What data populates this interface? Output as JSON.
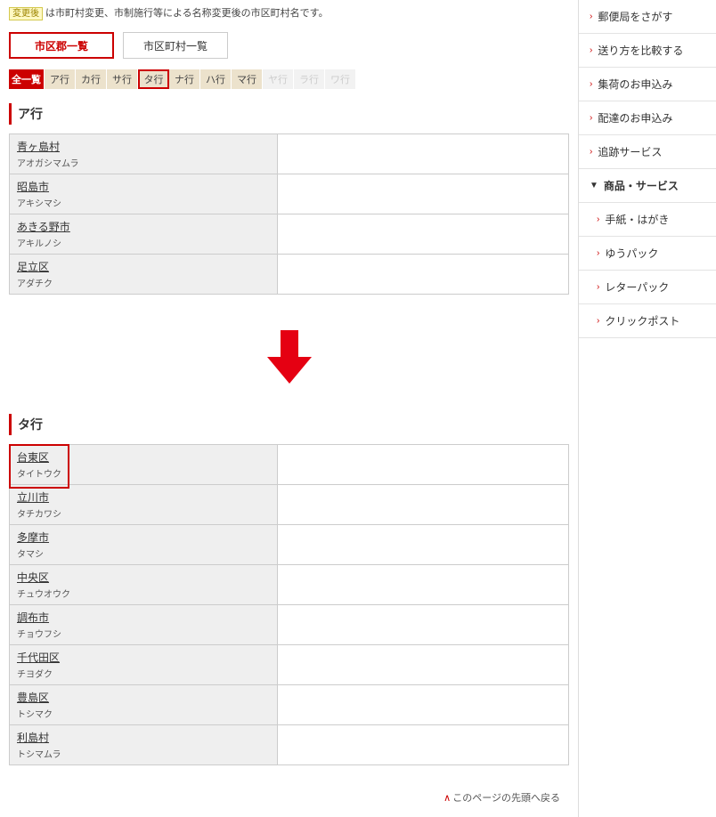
{
  "legend": {
    "badge": "変更後",
    "text": "は市町村変更、市制施行等による名称変更後の市区町村名です。"
  },
  "viewTabs": {
    "active": "市区郡一覧",
    "inactive": "市区町村一覧"
  },
  "kanaTabs": {
    "all": "全一覧",
    "items": [
      "ア行",
      "カ行",
      "サ行",
      "タ行",
      "ナ行",
      "ハ行",
      "マ行",
      "ヤ行",
      "ラ行",
      "ワ行"
    ],
    "highlighted": "タ行",
    "disabled": [
      "ヤ行",
      "ラ行",
      "ワ行"
    ]
  },
  "sectionA": {
    "heading": "ア行",
    "rows": [
      {
        "name": "青ヶ島村",
        "kana": "アオガシマムラ"
      },
      {
        "name": "昭島市",
        "kana": "アキシマシ"
      },
      {
        "name": "あきる野市",
        "kana": "アキルノシ"
      },
      {
        "name": "足立区",
        "kana": "アダチク"
      }
    ]
  },
  "sectionT": {
    "heading": "タ行",
    "rows": [
      {
        "name": "台東区",
        "kana": "タイトウク"
      },
      {
        "name": "立川市",
        "kana": "タチカワシ"
      },
      {
        "name": "多摩市",
        "kana": "タマシ"
      },
      {
        "name": "中央区",
        "kana": "チュウオウク"
      },
      {
        "name": "調布市",
        "kana": "チョウフシ"
      },
      {
        "name": "千代田区",
        "kana": "チヨダク"
      },
      {
        "name": "豊島区",
        "kana": "トシマク"
      },
      {
        "name": "利島村",
        "kana": "トシマムラ"
      }
    ]
  },
  "backToTop": "このページの先頭へ戻る",
  "sidebar": {
    "items": [
      {
        "label": "郵便局をさがす",
        "sub": false,
        "active": false
      },
      {
        "label": "送り方を比較する",
        "sub": false,
        "active": false
      },
      {
        "label": "集荷のお申込み",
        "sub": false,
        "active": false
      },
      {
        "label": "配達のお申込み",
        "sub": false,
        "active": false
      },
      {
        "label": "追跡サービス",
        "sub": false,
        "active": false
      },
      {
        "label": "商品・サービス",
        "sub": false,
        "active": true
      },
      {
        "label": "手紙・はがき",
        "sub": true,
        "active": false
      },
      {
        "label": "ゆうパック",
        "sub": true,
        "active": false
      },
      {
        "label": "レターパック",
        "sub": true,
        "active": false
      },
      {
        "label": "クリックポスト",
        "sub": true,
        "active": false
      }
    ]
  }
}
